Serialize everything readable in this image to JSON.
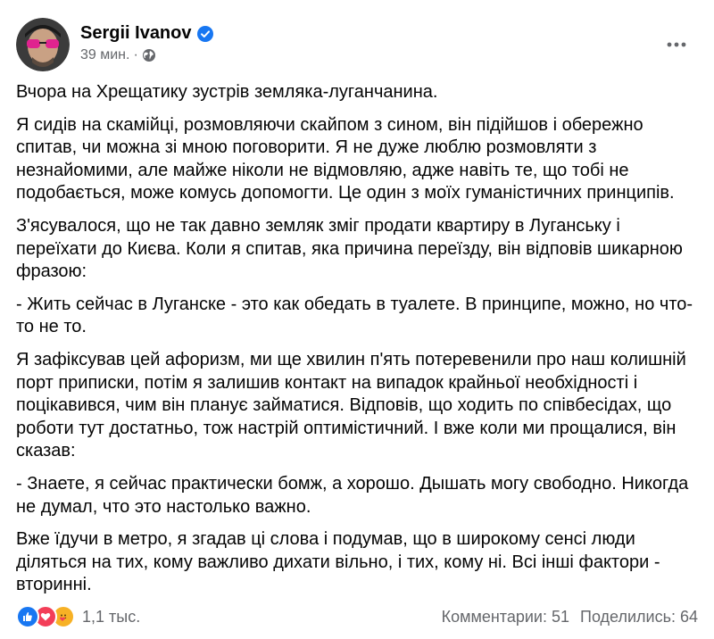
{
  "post": {
    "author": "Sergii Ivanov",
    "time": "39 мин.",
    "separator": "·",
    "paragraphs": [
      "Вчора на Хрещатику зустрів земляка-луганчанина.",
      "Я сидів на скамійці, розмовляючи скайпом з сином, він підійшов і обережно спитав, чи можна зі мною поговорити. Я не дуже люблю розмовляти з незнайомими, але майже ніколи не відмовляю, адже навіть те, що тобі не подобається, може комусь допомогти. Це один з моїх гуманістичних принципів.",
      "З'ясувалося, що не так давно земляк зміг продати квартиру в Луганську і переїхати до Києва. Коли я спитав, яка причина переїзду, він відповів шикарною фразою:",
      "- Жить сейчас в Луганске - это как обедать в туалете. В принципе, можно, но что-то не то.",
      "Я зафіксував цей афоризм, ми ще хвилин п'ять потеревенили про наш колишній порт приписки, потім я залишив контакт на випадок крайньої необхідності і поцікавився, чим він планує займатися. Відповів, що ходить по співбесідах, що роботи тут достатньо, тож настрій оптимістичний. І вже коли ми прощалися, він сказав:",
      "- Знаете, я сейчас практически бомж, а хорошо. Дышать могу свободно. Никогда не думал, что это настолько важно.",
      "Вже їдучи в метро, я згадав ці слова і подумав, що в широкому сенсі люди діляться на тих, кому важливо дихати вільно, і тих, кому ні. Всі інші фактори - вторинні."
    ]
  },
  "footer": {
    "reaction_count": "1,1 тыс.",
    "comments": "Комментарии: 51",
    "shares": "Поделились: 64"
  },
  "icons": {
    "verified": "verified-badge-icon",
    "globe": "globe-icon",
    "more": "more-options-icon",
    "reactions": [
      "like-icon",
      "love-icon",
      "care-icon"
    ]
  },
  "colors": {
    "primary_text": "#050505",
    "secondary_text": "#65676b",
    "verified_blue": "#1877f2",
    "like_blue": "#1877f2",
    "love_red": "#f33e58",
    "care_yellow": "#f7b125"
  }
}
